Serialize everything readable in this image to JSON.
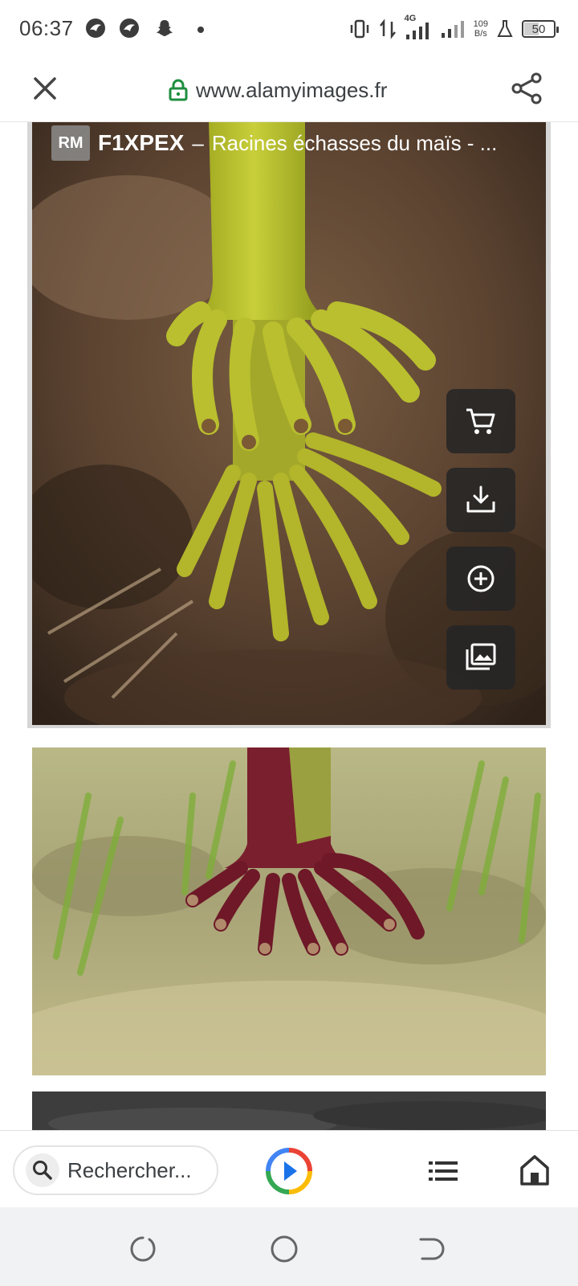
{
  "status_bar": {
    "time": "06:37",
    "notification_icons": [
      "bird-icon",
      "bird-icon",
      "snapchat-icon"
    ],
    "network": "4G",
    "net_speed_value": "109",
    "net_speed_unit": "B/s",
    "battery_level": "50"
  },
  "browser": {
    "url": "www.alamyimages.fr",
    "secure": true
  },
  "results": [
    {
      "license": "RM",
      "image_id": "F1XPEX",
      "separator": "–",
      "title": "Racines échasses du maïs - ...",
      "actions": [
        "cart-icon",
        "download-icon",
        "add-icon",
        "gallery-icon"
      ]
    }
  ],
  "bottom_toolbar": {
    "search_placeholder": "Rechercher..."
  },
  "colors": {
    "lock_green": "#1e8e3e",
    "action_bg": "#262626",
    "text": "#3c4043"
  }
}
